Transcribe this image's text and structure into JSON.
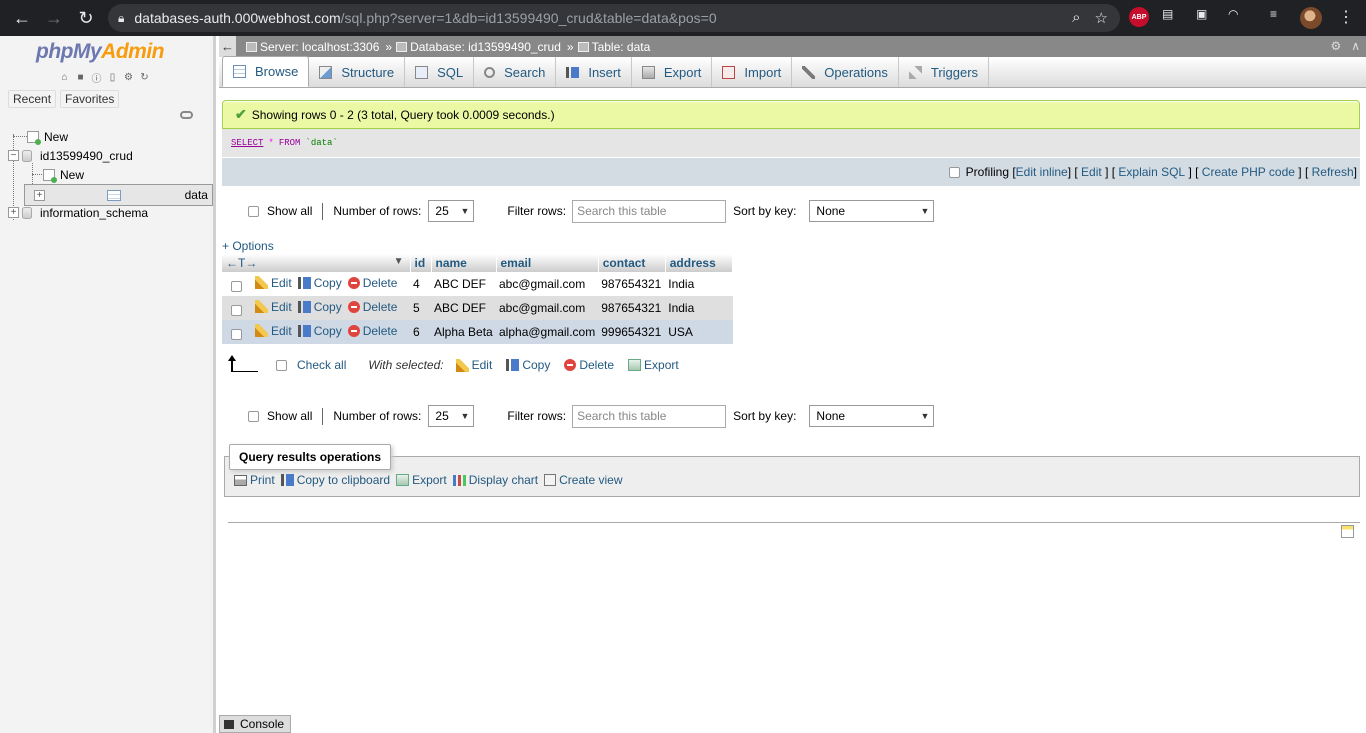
{
  "browser": {
    "url_host": "databases-auth.000webhost.com",
    "url_rest": "/sql.php?server=1&db=id13599490_crud&table=data&pos=0",
    "extension_abp": "ABP"
  },
  "sidebar": {
    "logo_php": "php",
    "logo_my": "My",
    "logo_admin": "Admin",
    "tabs": [
      "Recent",
      "Favorites"
    ],
    "tree": {
      "new_root": "New",
      "db": "id13599490_crud",
      "db_new": "New",
      "table": "data",
      "schema": "information_schema"
    }
  },
  "breadcrumb": {
    "server": "Server: localhost:3306",
    "database": "Database: id13599490_crud",
    "table": "Table: data",
    "separator": "»"
  },
  "menu": {
    "browse": "Browse",
    "structure": "Structure",
    "sql": "SQL",
    "search": "Search",
    "insert": "Insert",
    "export": "Export",
    "import": "Import",
    "operations": "Operations",
    "triggers": "Triggers"
  },
  "result": {
    "message": "Showing rows 0 - 2 (3 total, Query took 0.0009 seconds.)",
    "sql_select": "SELECT",
    "sql_star": "*",
    "sql_from": "FROM",
    "sql_table": "`data`"
  },
  "tools": {
    "profiling": "Profiling",
    "edit_inline": "Edit inline",
    "edit": "Edit",
    "explain": "Explain SQL",
    "create_php": "Create PHP code",
    "refresh": "Refresh"
  },
  "nav": {
    "show_all": "Show all",
    "num_rows_label": "Number of rows:",
    "num_rows_value": "25",
    "filter_label": "Filter rows:",
    "filter_placeholder": "Search this table",
    "sort_label": "Sort by key:",
    "sort_value": "None"
  },
  "options_link": "+ Options",
  "table": {
    "columns": [
      "id",
      "name",
      "email",
      "contact",
      "address"
    ],
    "rows": [
      {
        "id": "4",
        "name": "ABC DEF",
        "email": "abc@gmail.com",
        "contact": "987654321",
        "address": "India"
      },
      {
        "id": "5",
        "name": "ABC DEF",
        "email": "abc@gmail.com",
        "contact": "987654321",
        "address": "India"
      },
      {
        "id": "6",
        "name": "Alpha Beta",
        "email": "alpha@gmail.com",
        "contact": "999654321",
        "address": "USA"
      }
    ],
    "action_edit": "Edit",
    "action_copy": "Copy",
    "action_delete": "Delete",
    "arrows": "←T→"
  },
  "with_selected": {
    "check_all": "Check all",
    "label": "With selected:",
    "edit": "Edit",
    "copy": "Copy",
    "delete": "Delete",
    "export": "Export"
  },
  "qro": {
    "legend": "Query results operations",
    "print": "Print",
    "copy": "Copy to clipboard",
    "export": "Export",
    "chart": "Display chart",
    "view": "Create view"
  },
  "console": "Console"
}
